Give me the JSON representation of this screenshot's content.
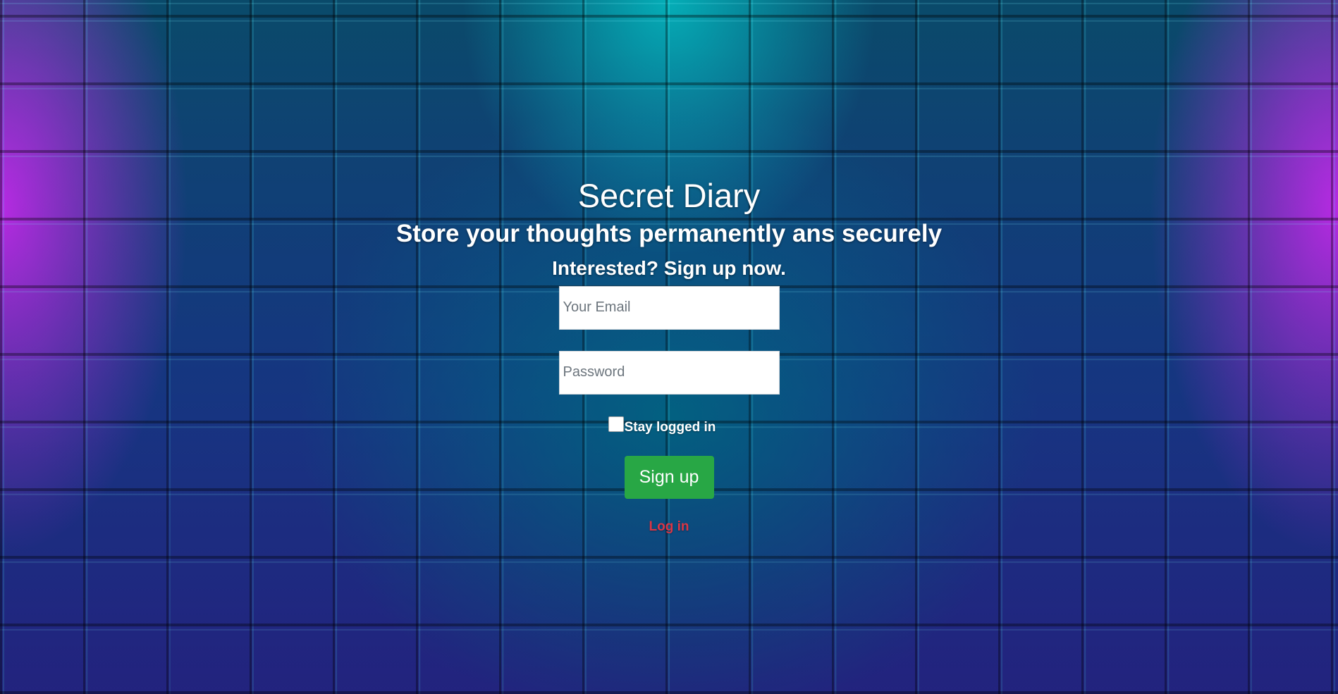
{
  "header": {
    "title": "Secret Diary",
    "subtitle": "Store your thoughts permanently ans securely",
    "cta": "Interested? Sign up now."
  },
  "form": {
    "email_placeholder": "Your Email",
    "email_value": "",
    "password_placeholder": "Password",
    "password_value": "",
    "stay_logged_in_label": "Stay logged in",
    "stay_logged_in_checked": false,
    "submit_label": "Sign up",
    "toggle_link_label": "Log in"
  },
  "colors": {
    "submit_button": "#28a745",
    "toggle_link": "#dc3545",
    "text": "#ffffff"
  }
}
